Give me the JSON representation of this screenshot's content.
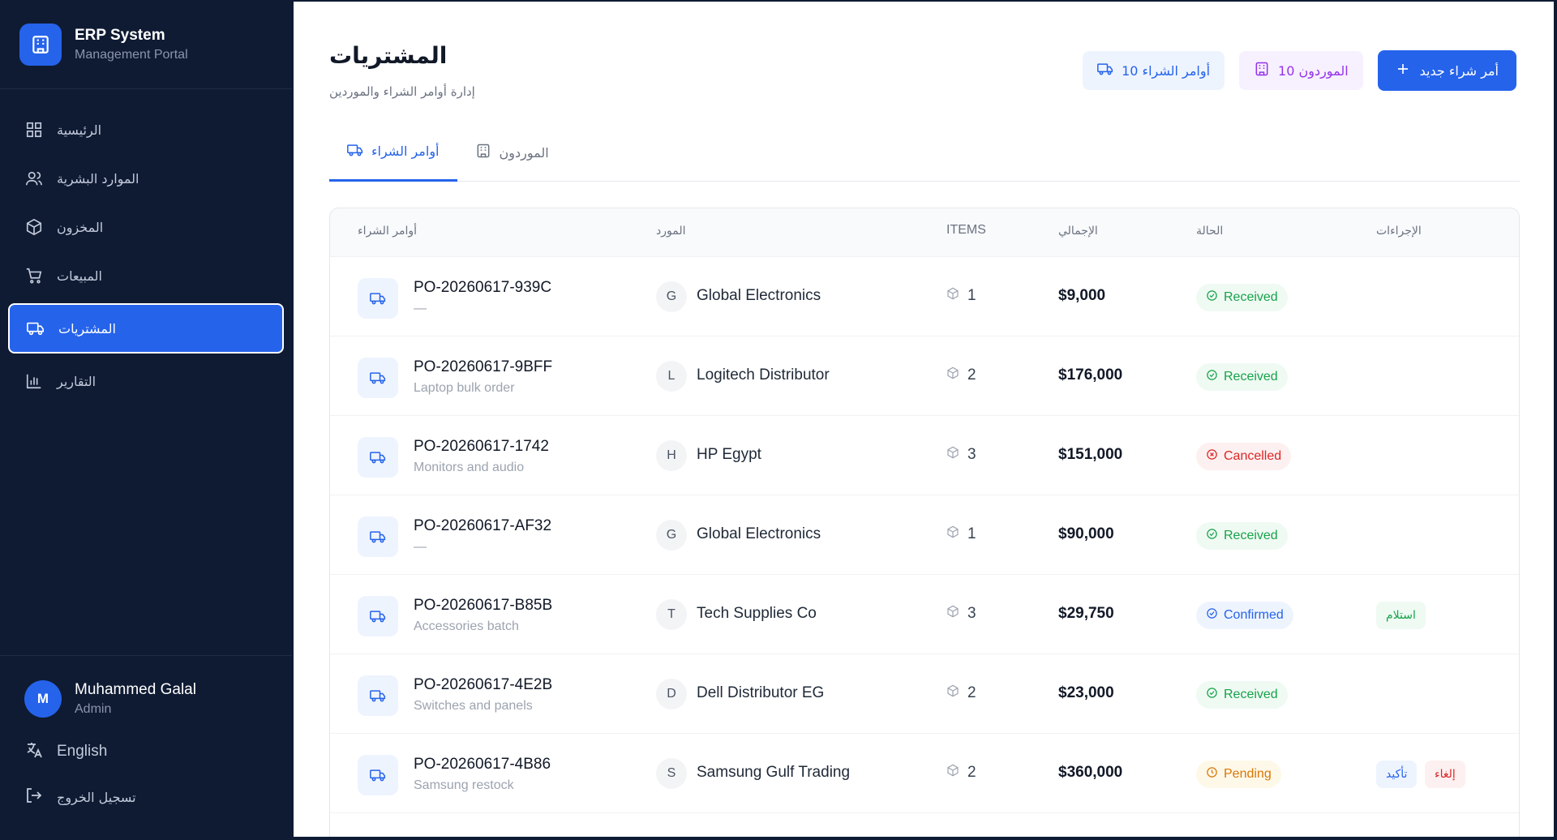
{
  "brand": {
    "title": "ERP System",
    "subtitle": "Management Portal"
  },
  "sidebar": {
    "items": [
      {
        "label": "الرئيسية",
        "icon": "grid-icon"
      },
      {
        "label": "الموارد البشرية",
        "icon": "users-icon"
      },
      {
        "label": "المخزون",
        "icon": "box-icon"
      },
      {
        "label": "المبيعات",
        "icon": "cart-icon"
      },
      {
        "label": "المشتريات",
        "icon": "truck-icon",
        "active": true
      },
      {
        "label": "التقارير",
        "icon": "bar-chart-icon"
      }
    ],
    "user": {
      "initial": "M",
      "name": "Muhammed Galal",
      "role": "Admin"
    },
    "language_label": "English",
    "logout_label": "تسجيل الخروج"
  },
  "header": {
    "title": "المشتريات",
    "subtitle": "إدارة أوامر الشراء والموردين",
    "po_chip": "أوامر الشراء 10",
    "supplier_chip": "الموردون 10",
    "new_button": "أمر شراء جديد"
  },
  "tabs": [
    {
      "label": "أوامر الشراء",
      "active": true
    },
    {
      "label": "الموردون",
      "active": false
    }
  ],
  "table": {
    "columns": {
      "po": "أوامر الشراء",
      "supplier": "المورد",
      "items": "ITEMS",
      "total": "الإجمالي",
      "status": "الحالة",
      "actions": "الإجراءات"
    },
    "rows": [
      {
        "id": "PO-20260617-939C",
        "desc": "—",
        "sup_initial": "G",
        "supplier": "Global Electronics",
        "items": "1",
        "total": "$9,000",
        "status": "Received",
        "status_kind": "received",
        "actions": []
      },
      {
        "id": "PO-20260617-9BFF",
        "desc": "Laptop bulk order",
        "sup_initial": "L",
        "supplier": "Logitech Distributor",
        "items": "2",
        "total": "$176,000",
        "status": "Received",
        "status_kind": "received",
        "actions": []
      },
      {
        "id": "PO-20260617-1742",
        "desc": "Monitors and audio",
        "sup_initial": "H",
        "supplier": "HP Egypt",
        "items": "3",
        "total": "$151,000",
        "status": "Cancelled",
        "status_kind": "cancelled",
        "actions": []
      },
      {
        "id": "PO-20260617-AF32",
        "desc": "—",
        "sup_initial": "G",
        "supplier": "Global Electronics",
        "items": "1",
        "total": "$90,000",
        "status": "Received",
        "status_kind": "received",
        "actions": []
      },
      {
        "id": "PO-20260617-B85B",
        "desc": "Accessories batch",
        "sup_initial": "T",
        "supplier": "Tech Supplies Co",
        "items": "3",
        "total": "$29,750",
        "status": "Confirmed",
        "status_kind": "confirmed",
        "actions": [
          {
            "label": "استلام",
            "kind": "receive"
          }
        ]
      },
      {
        "id": "PO-20260617-4E2B",
        "desc": "Switches and panels",
        "sup_initial": "D",
        "supplier": "Dell Distributor EG",
        "items": "2",
        "total": "$23,000",
        "status": "Received",
        "status_kind": "received",
        "actions": []
      },
      {
        "id": "PO-20260617-4B86",
        "desc": "Samsung restock",
        "sup_initial": "S",
        "supplier": "Samsung Gulf Trading",
        "items": "2",
        "total": "$360,000",
        "status": "Pending",
        "status_kind": "pending",
        "actions": [
          {
            "label": "تأكيد",
            "kind": "confirm"
          },
          {
            "label": "إلغاء",
            "kind": "cancel"
          }
        ]
      }
    ]
  },
  "colors": {
    "sidebar_bg": "#0f1b33",
    "accent": "#2563eb"
  }
}
